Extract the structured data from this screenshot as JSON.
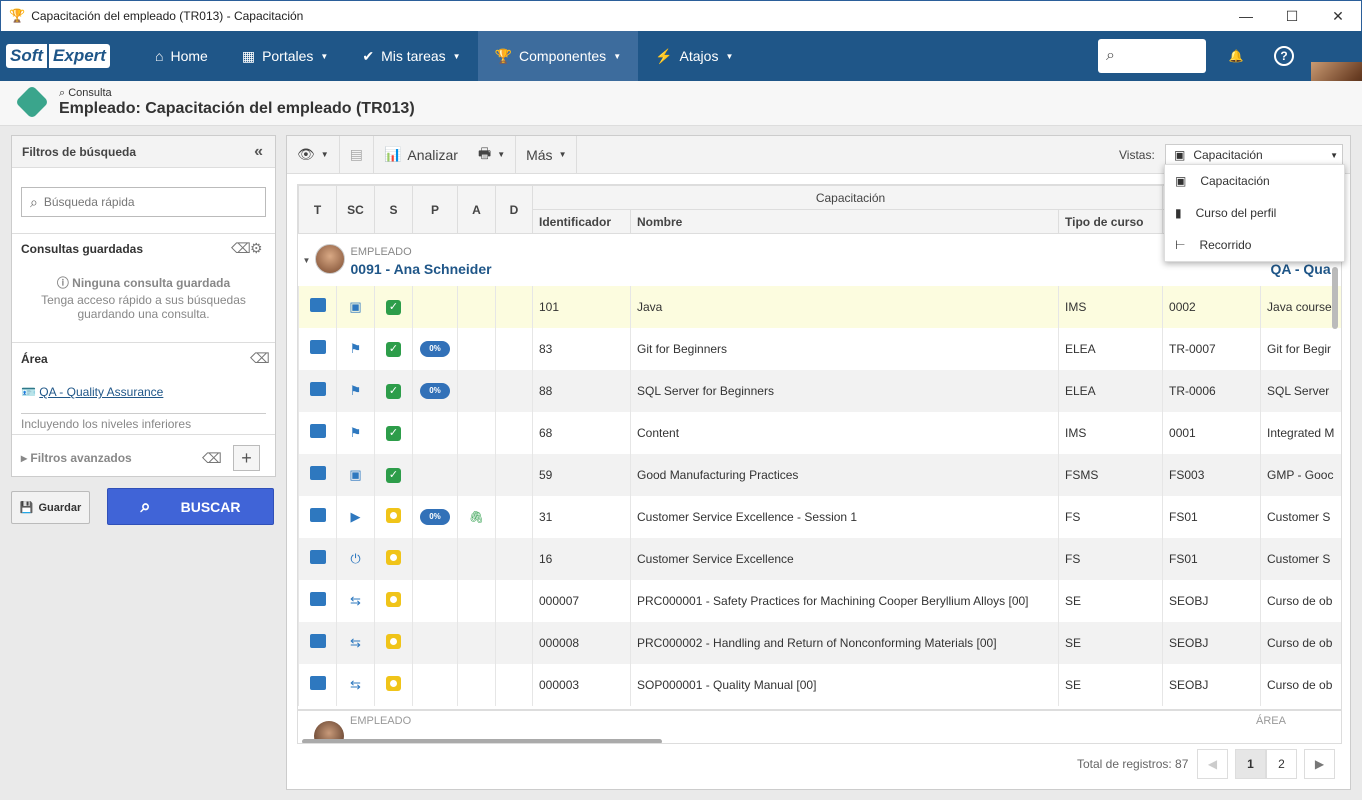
{
  "window": {
    "title": "Capacitación del empleado (TR013) - Capacitación",
    "controls": [
      "—",
      "☐",
      "✕"
    ]
  },
  "nav": {
    "logo_soft": "Soft",
    "logo_expert": "Expert",
    "items": [
      {
        "label": "Home",
        "icon": "home-icon"
      },
      {
        "label": "Portales",
        "icon": "grid-icon"
      },
      {
        "label": "Mis tareas",
        "icon": "check-icon"
      },
      {
        "label": "Componentes",
        "icon": "trophy-icon"
      },
      {
        "label": "Atajos",
        "icon": "bolt-icon"
      }
    ]
  },
  "header": {
    "breadcrumb": "Consulta",
    "title": "Empleado: Capacitación del empleado (TR013)"
  },
  "filters": {
    "title": "Filtros de búsqueda",
    "quick_search_placeholder": "Búsqueda rápida",
    "saved_title": "Consultas guardadas",
    "none_saved": "Ninguna consulta guardada",
    "saved_hint": "Tenga acceso rápido a sus búsquedas guardando una consulta.",
    "area_title": "Área",
    "area_value": "QA - Quality Assurance",
    "area_note": "Incluyendo los niveles inferiores",
    "advanced": "Filtros avanzados",
    "save_btn": "Guardar",
    "search_btn": "BUSCAR"
  },
  "toolbar": {
    "analyze": "Analizar",
    "more": "Más",
    "views_label": "Vistas:",
    "view_selected": "Capacitación"
  },
  "views_menu": [
    "Capacitación",
    "Curso del perfil",
    "Recorrido"
  ],
  "table": {
    "group_header": "Capacitación",
    "cols": [
      "T",
      "SC",
      "S",
      "P",
      "A",
      "D",
      "Identificador",
      "Nombre",
      "Tipo de curso"
    ],
    "group1": {
      "label": "EMPLEADO",
      "name": "0091 - Ana Schneider",
      "area": "QA - Qua"
    },
    "rows": [
      {
        "sc": "clip",
        "s": "green",
        "p": "",
        "a": "",
        "id": "101",
        "name": "Java",
        "type": "IMS",
        "code": "0002",
        "desc": "Java course"
      },
      {
        "sc": "flag",
        "s": "green",
        "p": "0%",
        "a": "",
        "id": "83",
        "name": "Git for Beginners",
        "type": "ELEA",
        "code": "TR-0007",
        "desc": "Git for Begir"
      },
      {
        "sc": "flag",
        "s": "green",
        "p": "0%",
        "a": "",
        "id": "88",
        "name": "SQL Server for Beginners",
        "type": "ELEA",
        "code": "TR-0006",
        "desc": "SQL Server"
      },
      {
        "sc": "flag",
        "s": "green",
        "p": "",
        "a": "",
        "id": "68",
        "name": "Content",
        "type": "IMS",
        "code": "0001",
        "desc": "Integrated M"
      },
      {
        "sc": "clip",
        "s": "green",
        "p": "",
        "a": "",
        "id": "59",
        "name": "Good Manufacturing Practices",
        "type": "FSMS",
        "code": "FS003",
        "desc": "GMP - Gooc"
      },
      {
        "sc": "play",
        "s": "yellow",
        "p": "0%",
        "a": "clip",
        "id": "31",
        "name": "Customer Service Excellence - Session 1",
        "type": "FS",
        "code": "FS01",
        "desc": "Customer S"
      },
      {
        "sc": "power",
        "s": "yellow",
        "p": "",
        "a": "",
        "id": "16",
        "name": "Customer Service Excellence",
        "type": "FS",
        "code": "FS01",
        "desc": "Customer S"
      },
      {
        "sc": "proc",
        "s": "yellow",
        "p": "",
        "a": "",
        "id": "000007",
        "name": "PRC000001 - Safety Practices for Machining Cooper Beryllium Alloys [00]",
        "type": "SE",
        "code": "SEOBJ",
        "desc": "Curso de ob"
      },
      {
        "sc": "proc",
        "s": "yellow",
        "p": "",
        "a": "",
        "id": "000008",
        "name": "PRC000002 - Handling and Return of Nonconforming Materials [00]",
        "type": "SE",
        "code": "SEOBJ",
        "desc": "Curso de ob"
      },
      {
        "sc": "proc",
        "s": "yellow",
        "p": "",
        "a": "",
        "id": "000003",
        "name": "SOP000001 - Quality Manual [00]",
        "type": "SE",
        "code": "SEOBJ",
        "desc": "Curso de ob"
      }
    ],
    "group2": {
      "label": "EMPLEADO",
      "area": "ÁREA"
    }
  },
  "footer": {
    "total": "Total de registros: 87",
    "pages": [
      "1",
      "2"
    ]
  }
}
